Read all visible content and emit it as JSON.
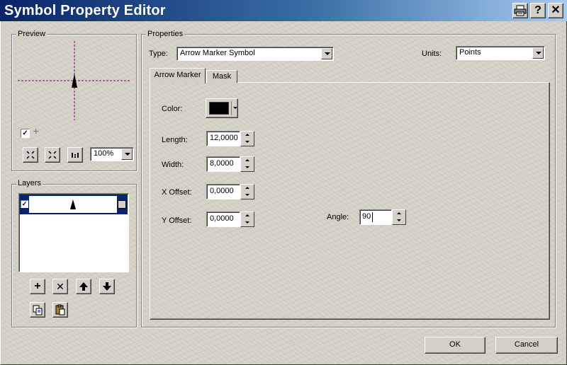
{
  "window": {
    "title": "Symbol Property Editor",
    "buttons": {
      "print": "print-icon",
      "help": "?",
      "close": "✕"
    }
  },
  "preview": {
    "label": "Preview",
    "zoom": "100%",
    "show_crosshair_checked": true,
    "crosshair_color": "#800080"
  },
  "layers": {
    "label": "Layers",
    "items": [
      {
        "checked": true,
        "selected": true
      }
    ],
    "selection_color": "#0a246a"
  },
  "properties": {
    "label": "Properties",
    "type_label": "Type:",
    "type_value": "Arrow Marker Symbol",
    "units_label": "Units:",
    "units_value": "Points",
    "tabs": [
      {
        "label": "Arrow Marker",
        "active": true
      },
      {
        "label": "Mask",
        "active": false
      }
    ],
    "color_label": "Color:",
    "color_value": "#000000",
    "length_label": "Length:",
    "length_value": "12,0000",
    "width_label": "Width:",
    "width_value": "8,0000",
    "xoffset_label": "X Offset:",
    "xoffset_value": "0,0000",
    "yoffset_label": "Y Offset:",
    "yoffset_value": "0,0000",
    "angle_label": "Angle:",
    "angle_value": "90"
  },
  "footer": {
    "ok_label": "OK",
    "cancel_label": "Cancel"
  }
}
